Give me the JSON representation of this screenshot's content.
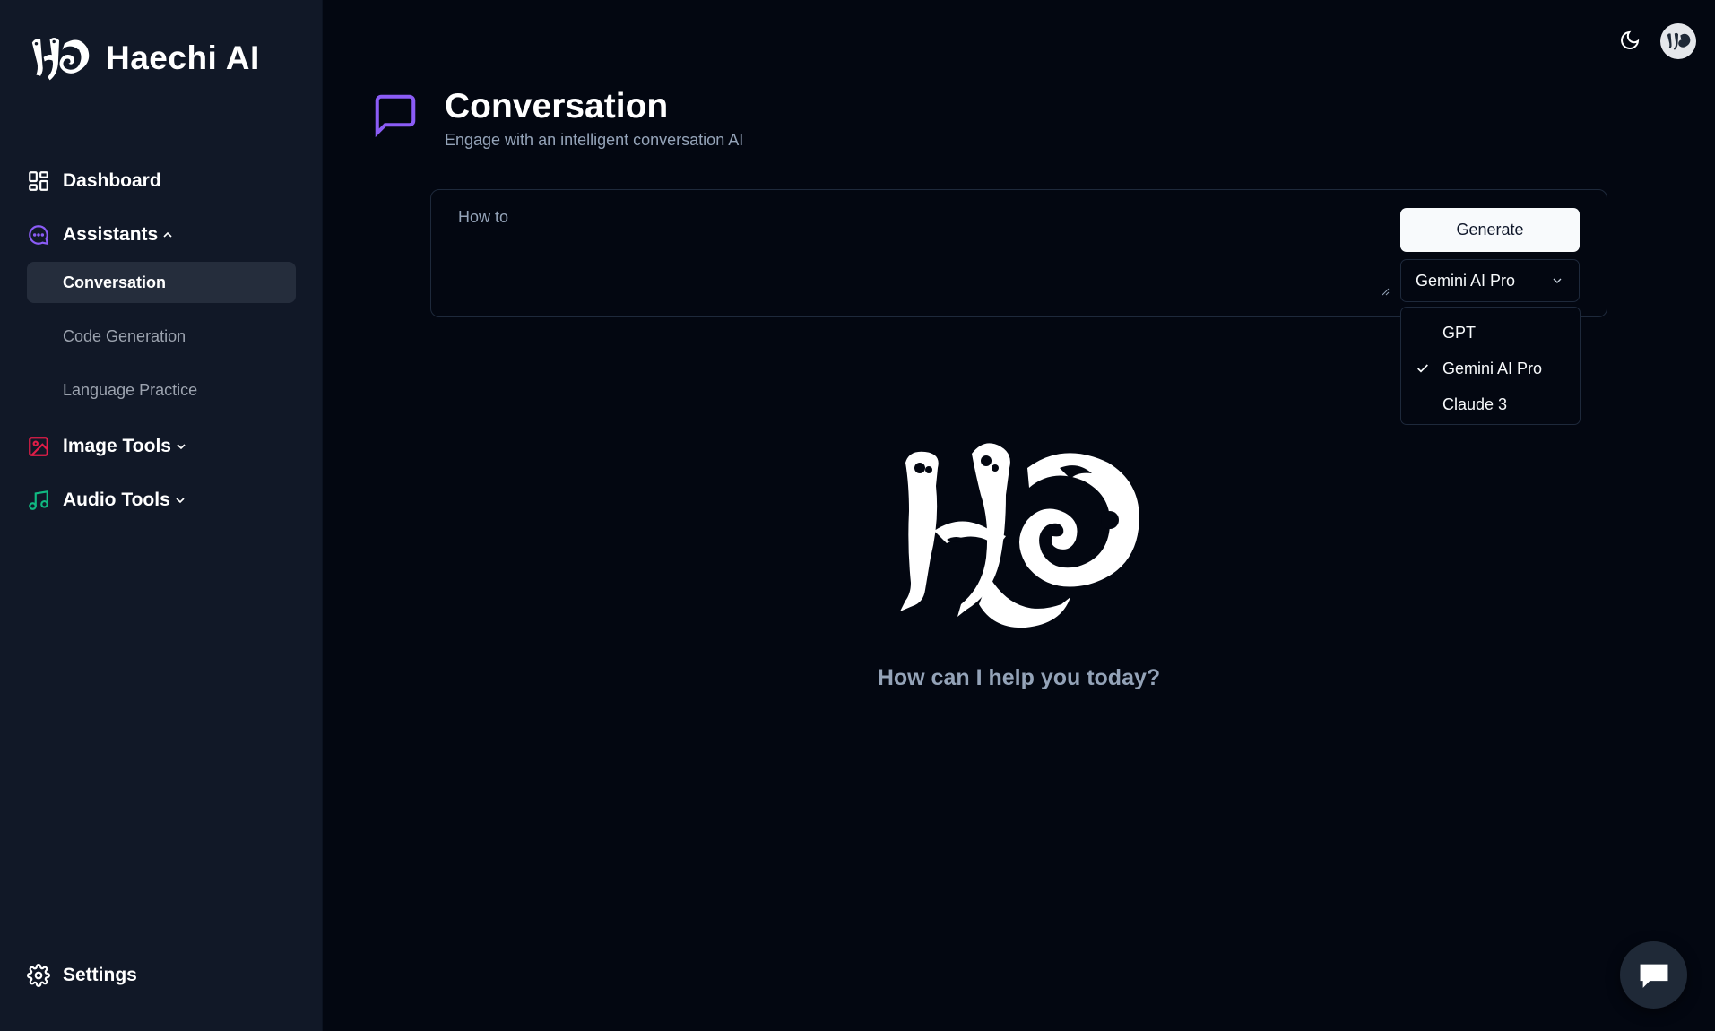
{
  "brand": {
    "name": "Haechi AI",
    "logo_icon": "haechi-logo-icon"
  },
  "sidebar": {
    "items": [
      {
        "label": "Dashboard",
        "icon": "dashboard-grid-icon",
        "color": "#ffffff"
      },
      {
        "label": "Assistants",
        "icon": "chat-bubble-icon",
        "color": "#8b5cf6",
        "expanded": true,
        "children": [
          "Conversation",
          "Code Generation",
          "Language Practice"
        ],
        "active_child": "Conversation"
      },
      {
        "label": "Image Tools",
        "icon": "image-icon",
        "color": "#e11d48",
        "expanded": false
      },
      {
        "label": "Audio Tools",
        "icon": "music-note-icon",
        "color": "#10b981",
        "expanded": false
      }
    ],
    "settings_label": "Settings"
  },
  "topbar": {
    "theme_icon": "moon-icon",
    "avatar_icon": "user-avatar-icon"
  },
  "header": {
    "title": "Conversation",
    "subtitle": "Engage with an intelligent conversation AI",
    "icon": "message-square-icon",
    "icon_color": "#8b5cf6"
  },
  "form": {
    "prompt_value": "How to",
    "generate_label": "Generate",
    "selected_model": "Gemini AI Pro",
    "options": [
      "GPT",
      "Gemini AI Pro",
      "Claude 3"
    ]
  },
  "empty_state": {
    "message": "How can I help you today?"
  },
  "colors": {
    "background": "#030711",
    "sidebar": "#111827",
    "accent": "#8b5cf6"
  }
}
